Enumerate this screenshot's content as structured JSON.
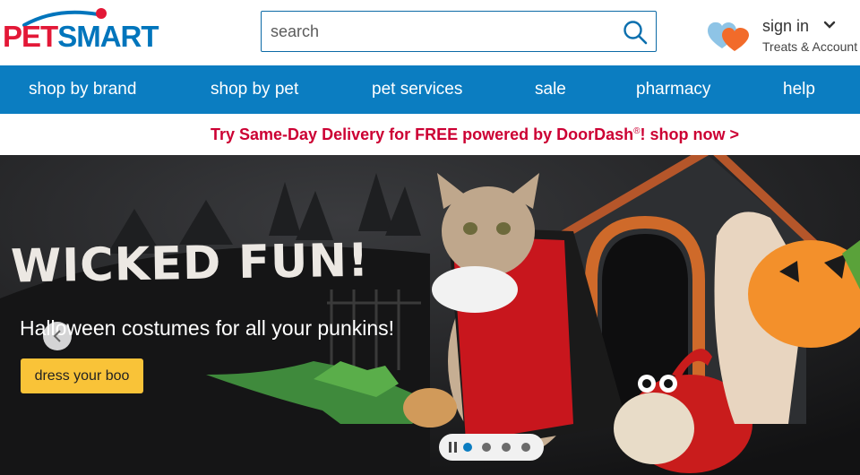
{
  "brand": {
    "logo_text_1": "PET",
    "logo_text_2": "SMART",
    "primary_red": "#e31837",
    "primary_blue": "#0075bc"
  },
  "search": {
    "placeholder": "search",
    "icon": "search-icon"
  },
  "account": {
    "sign_in_label": "sign in",
    "subtitle": "Treats & Account",
    "icon": "hearts-icon"
  },
  "nav": {
    "background": "#0b7dc1",
    "items": [
      {
        "label": "shop by brand"
      },
      {
        "label": "shop by pet"
      },
      {
        "label": "pet services"
      },
      {
        "label": "sale"
      },
      {
        "label": "pharmacy"
      },
      {
        "label": "help"
      }
    ]
  },
  "promo": {
    "text_before": "Try Same-Day Delivery for FREE powered by DoorDash",
    "registered": "®",
    "text_after": "! shop now >",
    "color": "#cc0033"
  },
  "hero": {
    "title": "WICKED FUN!",
    "subtitle": "Halloween costumes for all your punkins!",
    "cta_label": "dress your boo",
    "cta_color": "#f9c338",
    "slide_count": 4,
    "active_slide": 1
  }
}
